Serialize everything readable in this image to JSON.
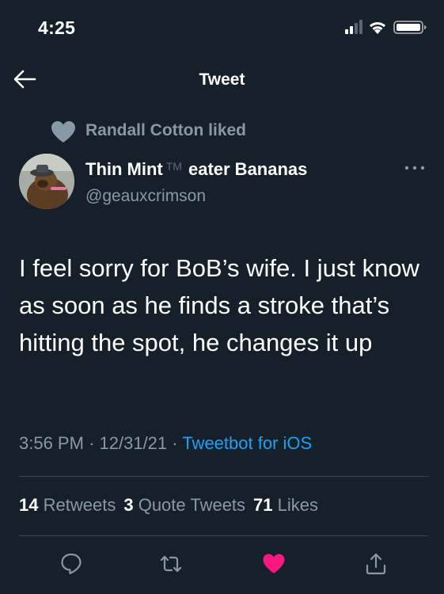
{
  "status_bar": {
    "time": "4:25"
  },
  "nav": {
    "title": "Tweet"
  },
  "social_context": {
    "text": "Randall Cotton liked"
  },
  "author": {
    "name_part1": "Thin Mint",
    "trademark": "TM",
    "name_part2": "eater Bananas",
    "handle": "@geauxcrimson"
  },
  "tweet": {
    "text": "I feel sorry for BoB’s wife. I just know as soon as he finds a stroke that’s hitting the spot, he changes it up",
    "time": "3:56 PM",
    "separator1": "·",
    "date": "12/31/21",
    "separator2": "·",
    "source": "Tweetbot for iOS"
  },
  "stats": {
    "retweets_count": "14",
    "retweets_label": "Retweets",
    "quotes_count": "3",
    "quotes_label": "Quote Tweets",
    "likes_count": "71",
    "likes_label": "Likes"
  },
  "actions": {
    "reply_icon": "reply-icon",
    "retweet_icon": "retweet-icon",
    "like_icon": "heart-icon",
    "share_icon": "share-icon"
  },
  "colors": {
    "background": "#15202b",
    "secondary_text": "#8899a6",
    "link": "#1da1f2",
    "like": "#f91880",
    "divider": "#38444d"
  },
  "liked": true
}
